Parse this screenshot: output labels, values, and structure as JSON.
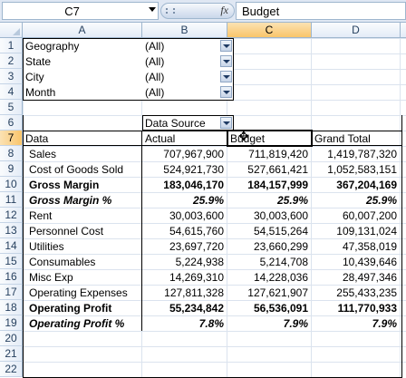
{
  "formula_bar": {
    "name_box": "C7",
    "fx_label": "fx",
    "content": "Budget"
  },
  "columns": [
    "A",
    "B",
    "C",
    "D"
  ],
  "rows": [
    "1",
    "2",
    "3",
    "4",
    "5",
    "6",
    "7",
    "8",
    "9",
    "10",
    "11",
    "12",
    "13",
    "14",
    "15",
    "16",
    "17",
    "18",
    "19",
    "20",
    "21",
    "22"
  ],
  "filters": [
    {
      "label": "Geography",
      "value": "(All)"
    },
    {
      "label": "State",
      "value": "(All)"
    },
    {
      "label": "City",
      "value": "(All)"
    },
    {
      "label": "Month",
      "value": "(All)"
    }
  ],
  "data_source_label": "Data Source",
  "table_header": [
    "Data",
    "Actual",
    "Budget",
    "Grand Total"
  ],
  "table_rows": [
    {
      "label": "Sales",
      "style": "normal",
      "values": [
        "707,967,900",
        "711,819,420",
        "1,419,787,320"
      ]
    },
    {
      "label": "Cost of Goods Sold",
      "style": "normal",
      "values": [
        "524,921,730",
        "527,661,421",
        "1,052,583,151"
      ]
    },
    {
      "label": "Gross Margin",
      "style": "bold",
      "values": [
        "183,046,170",
        "184,157,999",
        "367,204,169"
      ]
    },
    {
      "label": "Gross Margin %",
      "style": "bolditalic",
      "values": [
        "25.9%",
        "25.9%",
        "25.9%"
      ]
    },
    {
      "label": "Rent",
      "style": "normal",
      "values": [
        "30,003,600",
        "30,003,600",
        "60,007,200"
      ]
    },
    {
      "label": "Personnel Cost",
      "style": "normal",
      "values": [
        "54,615,760",
        "54,515,264",
        "109,131,024"
      ]
    },
    {
      "label": "Utilities",
      "style": "normal",
      "values": [
        "23,697,720",
        "23,660,299",
        "47,358,019"
      ]
    },
    {
      "label": "Consumables",
      "style": "normal",
      "values": [
        "5,224,938",
        "5,214,708",
        "10,439,646"
      ]
    },
    {
      "label": "Misc Exp",
      "style": "normal",
      "values": [
        "14,269,310",
        "14,228,036",
        "28,497,346"
      ]
    },
    {
      "label": "Operating Expenses",
      "style": "normal",
      "values": [
        "127,811,328",
        "127,621,907",
        "255,433,235"
      ]
    },
    {
      "label": "Operating Profit",
      "style": "bold",
      "values": [
        "55,234,842",
        "56,536,091",
        "111,770,933"
      ]
    },
    {
      "label": "Operating Profit %",
      "style": "bolditalic",
      "values": [
        "7.8%",
        "7.9%",
        "7.9%"
      ]
    }
  ],
  "colors": {
    "header_bg": "#e4ecf7",
    "selected_header": "#f9c56a",
    "grid": "#dbe3ee"
  },
  "icons": {
    "move_cursor": "move-cursor-icon",
    "dropdown": "dropdown-arrow-icon"
  }
}
